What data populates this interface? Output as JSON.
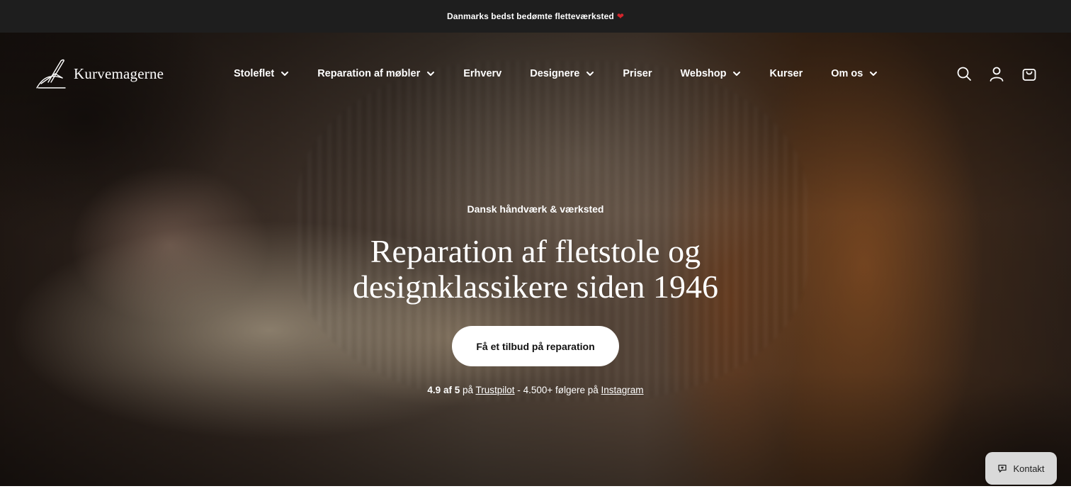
{
  "announcement": {
    "text": "Danmarks bedst bedømte fletteværksted",
    "heart": "❤"
  },
  "header": {
    "logo_text": "Kurvemagerne",
    "nav": [
      {
        "label": "Stoleflet",
        "has_dropdown": true
      },
      {
        "label": "Reparation af møbler",
        "has_dropdown": true
      },
      {
        "label": "Erhverv",
        "has_dropdown": false
      },
      {
        "label": "Designere",
        "has_dropdown": true
      },
      {
        "label": "Priser",
        "has_dropdown": false
      },
      {
        "label": "Webshop",
        "has_dropdown": true
      },
      {
        "label": "Kurser",
        "has_dropdown": false
      },
      {
        "label": "Om os",
        "has_dropdown": true
      }
    ],
    "icons": [
      "search-icon",
      "account-icon",
      "cart-icon"
    ]
  },
  "hero": {
    "eyebrow": "Dansk håndværk & værksted",
    "headline_line1": "Reparation af fletstole og",
    "headline_line2": "designklassikere siden 1946",
    "cta_label": "Få et tilbud på reparation",
    "rating": "4.9 af 5",
    "rating_on": "på",
    "trustpilot": "Trustpilot",
    "separator": "-",
    "followers": "4.500+ følgere på",
    "instagram": "Instagram"
  },
  "contact": {
    "label": "Kontakt",
    "icon": "chat-heart-icon"
  }
}
